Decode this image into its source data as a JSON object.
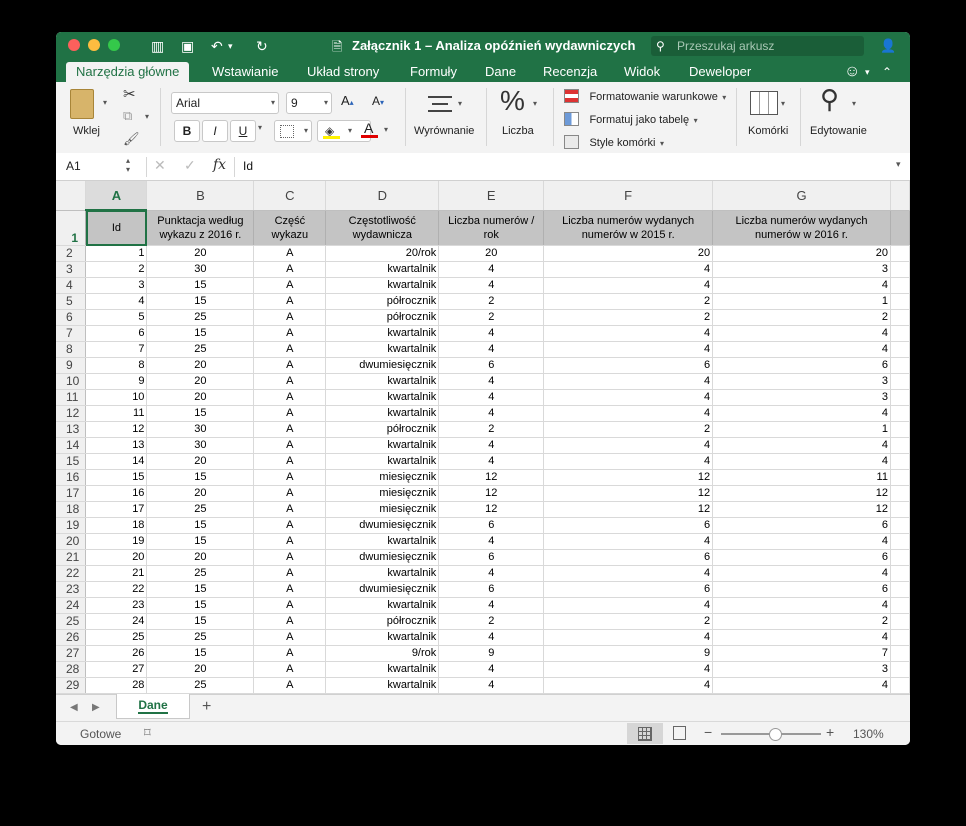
{
  "window": {
    "title": "Załącznik 1 – Analiza opóźnień wydawniczych",
    "search_placeholder": "Przeszukaj arkusz"
  },
  "tabs": [
    "Narzędzia główne",
    "Wstawianie",
    "Układ strony",
    "Formuły",
    "Dane",
    "Recenzja",
    "Widok",
    "Deweloper"
  ],
  "ribbon": {
    "paste": "Wklej",
    "font_name": "Arial",
    "font_size": "9",
    "bold": "B",
    "italic": "I",
    "underline": "U",
    "alignment": "Wyrównanie",
    "number": "Liczba",
    "conditional_formatting": "Formatowanie warunkowe",
    "format_as_table": "Formatuj jako tabelę",
    "cell_styles": "Style komórki",
    "cells": "Komórki",
    "editing": "Edytowanie"
  },
  "formula_bar": {
    "name_box": "A1",
    "fx": "fx",
    "content": "Id"
  },
  "columns": [
    "A",
    "B",
    "C",
    "D",
    "E",
    "F",
    "G"
  ],
  "header_row": [
    "Id",
    "Punktacja według wykazu z 2016 r.",
    "Część wykazu",
    "Częstotliwość wydawnicza",
    "Liczba numerów / rok",
    "Liczba numerów wydanych numerów w 2015 r.",
    "Liczba numerów wydanych numerów w 2016 r."
  ],
  "rows": [
    [
      "1",
      "20",
      "A",
      "20/rok",
      "20",
      "20",
      "20"
    ],
    [
      "2",
      "30",
      "A",
      "kwartalnik",
      "4",
      "4",
      "3"
    ],
    [
      "3",
      "15",
      "A",
      "kwartalnik",
      "4",
      "4",
      "4"
    ],
    [
      "4",
      "15",
      "A",
      "półrocznik",
      "2",
      "2",
      "1"
    ],
    [
      "5",
      "25",
      "A",
      "półrocznik",
      "2",
      "2",
      "2"
    ],
    [
      "6",
      "15",
      "A",
      "kwartalnik",
      "4",
      "4",
      "4"
    ],
    [
      "7",
      "25",
      "A",
      "kwartalnik",
      "4",
      "4",
      "4"
    ],
    [
      "8",
      "20",
      "A",
      "dwumiesięcznik",
      "6",
      "6",
      "6"
    ],
    [
      "9",
      "20",
      "A",
      "kwartalnik",
      "4",
      "4",
      "3"
    ],
    [
      "10",
      "20",
      "A",
      "kwartalnik",
      "4",
      "4",
      "3"
    ],
    [
      "11",
      "15",
      "A",
      "kwartalnik",
      "4",
      "4",
      "4"
    ],
    [
      "12",
      "30",
      "A",
      "półrocznik",
      "2",
      "2",
      "1"
    ],
    [
      "13",
      "30",
      "A",
      "kwartalnik",
      "4",
      "4",
      "4"
    ],
    [
      "14",
      "20",
      "A",
      "kwartalnik",
      "4",
      "4",
      "4"
    ],
    [
      "15",
      "15",
      "A",
      "miesięcznik",
      "12",
      "12",
      "11"
    ],
    [
      "16",
      "20",
      "A",
      "miesięcznik",
      "12",
      "12",
      "12"
    ],
    [
      "17",
      "25",
      "A",
      "miesięcznik",
      "12",
      "12",
      "12"
    ],
    [
      "18",
      "15",
      "A",
      "dwumiesięcznik",
      "6",
      "6",
      "6"
    ],
    [
      "19",
      "15",
      "A",
      "kwartalnik",
      "4",
      "4",
      "4"
    ],
    [
      "20",
      "20",
      "A",
      "dwumiesięcznik",
      "6",
      "6",
      "6"
    ],
    [
      "21",
      "25",
      "A",
      "kwartalnik",
      "4",
      "4",
      "4"
    ],
    [
      "22",
      "15",
      "A",
      "dwumiesięcznik",
      "6",
      "6",
      "6"
    ],
    [
      "23",
      "15",
      "A",
      "kwartalnik",
      "4",
      "4",
      "4"
    ],
    [
      "24",
      "15",
      "A",
      "półrocznik",
      "2",
      "2",
      "2"
    ],
    [
      "25",
      "25",
      "A",
      "kwartalnik",
      "4",
      "4",
      "4"
    ],
    [
      "26",
      "15",
      "A",
      "9/rok",
      "9",
      "9",
      "7"
    ],
    [
      "27",
      "20",
      "A",
      "kwartalnik",
      "4",
      "4",
      "3"
    ],
    [
      "28",
      "25",
      "A",
      "kwartalnik",
      "4",
      "4",
      "4"
    ]
  ],
  "sheet_tab": "Dane",
  "status": {
    "ready": "Gotowe",
    "zoom": "130%"
  },
  "colors": {
    "accent": "#207245",
    "header_fill": "#c4c4c4"
  }
}
